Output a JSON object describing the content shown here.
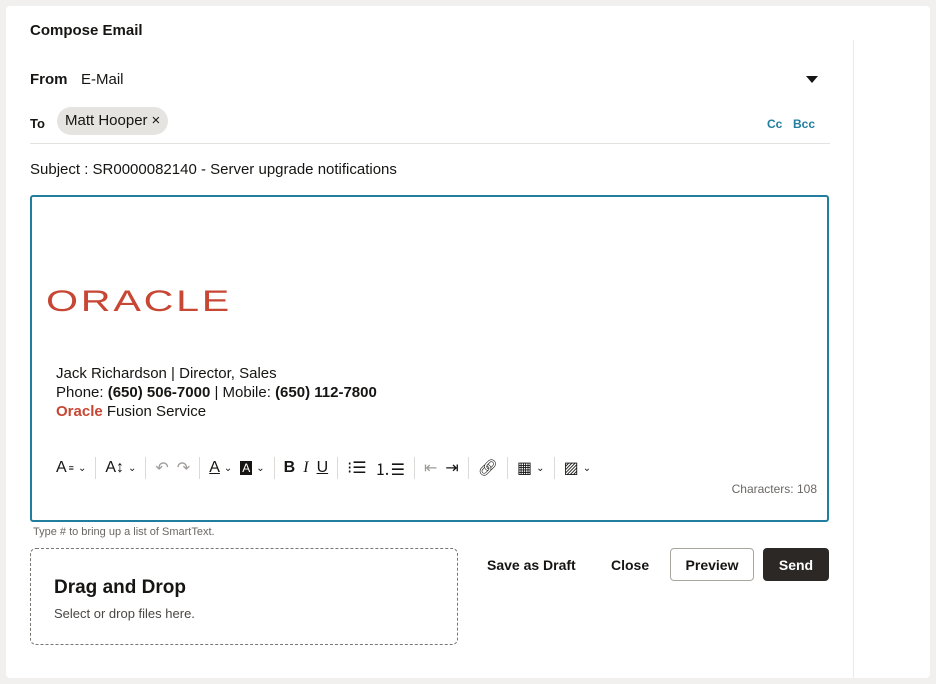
{
  "title": "Compose Email",
  "from": {
    "label": "From",
    "value": "E-Mail"
  },
  "to": {
    "label": "To",
    "recipient": "Matt Hooper",
    "remove": "×",
    "cc": "Cc",
    "bcc": "Bcc"
  },
  "subject": "Subject : SR0000082140 - Server upgrade notifications",
  "signature": {
    "logo_text": "ORACLE",
    "line1": "Jack Richardson | Director, Sales",
    "phone_label": "Phone: ",
    "phone": "(650) 506-7000",
    "mobile_label": " | Mobile: ",
    "mobile": "(650) 112-7800",
    "brand": "Oracle",
    "product": " Fusion Service"
  },
  "toolbar": {
    "icons": [
      "font-size-icon",
      "font-style-icon",
      "undo-icon",
      "redo-icon",
      "font-color-icon",
      "highlight-color-icon",
      "bold-icon",
      "italic-icon",
      "underline-icon",
      "bulleted-list-icon",
      "numbered-list-icon",
      "outdent-icon",
      "indent-icon",
      "link-icon",
      "table-icon",
      "image-icon"
    ]
  },
  "characters": "Characters: 108",
  "hint": "Type # to bring up a list of SmartText.",
  "dropzone": {
    "title": "Drag and Drop",
    "subtitle": "Select or drop files here."
  },
  "actions": {
    "save_draft": "Save as Draft",
    "close": "Close",
    "preview": "Preview",
    "send": "Send"
  },
  "colors": {
    "accent": "#227e9e",
    "oracle_red": "#c74634",
    "send_bg": "#2b2826"
  }
}
